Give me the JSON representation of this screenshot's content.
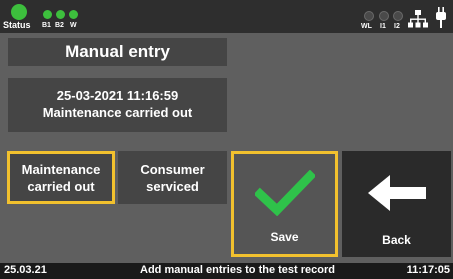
{
  "status": {
    "status_label": "Status",
    "b1_label": "B1",
    "b2_label": "B2",
    "w_label": "W",
    "wl_label": "WL",
    "i1_label": "I1",
    "i2_label": "I2"
  },
  "header": {
    "title": "Manual  entry"
  },
  "record": {
    "datetime": "25-03-2021 11:16:59",
    "entry": "Maintenance  carried out"
  },
  "options": [
    {
      "line1": "Maintenance",
      "line2": "carried out",
      "selected": true
    },
    {
      "line1": "Consumer",
      "line2": "serviced",
      "selected": false
    }
  ],
  "actions": {
    "save_label": "Save",
    "back_label": "Back"
  },
  "footer": {
    "date": "25.03.21",
    "message": "Add manual entries to the test record",
    "time": "11:17:05"
  },
  "colors": {
    "selected_border": "#f2c12e",
    "status_green": "#3dbf3d",
    "check_green": "#2fc24a"
  },
  "icons": {
    "save": "check-icon",
    "back": "arrow-left-icon",
    "network": "network-icon",
    "power": "plug-icon"
  }
}
